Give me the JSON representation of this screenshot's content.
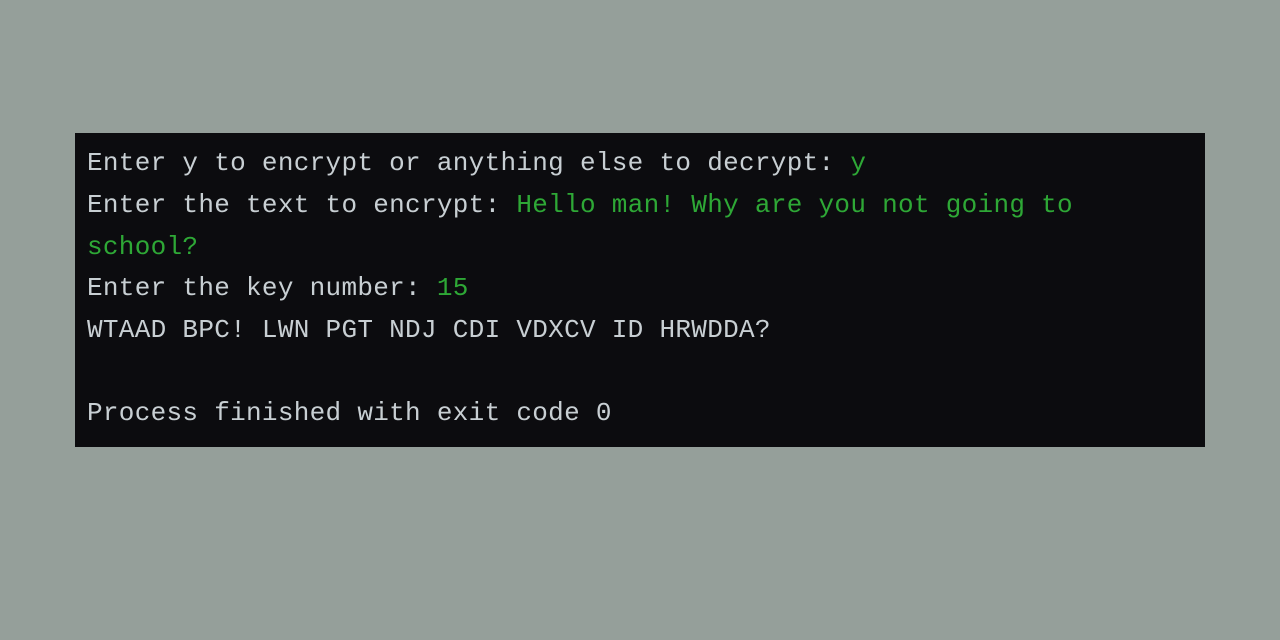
{
  "terminal": {
    "lines": [
      {
        "prompt": "Enter y to encrypt or anything else to decrypt: ",
        "input": "y"
      },
      {
        "prompt": "Enter the text to encrypt: ",
        "input": "Hello man! Why are you not going to school?"
      },
      {
        "prompt": "Enter the key number: ",
        "input": "15"
      }
    ],
    "output": "WTAAD BPC! LWN PGT NDJ CDI VDXCV ID HRWDDA?",
    "exit_message": "Process finished with exit code 0"
  }
}
